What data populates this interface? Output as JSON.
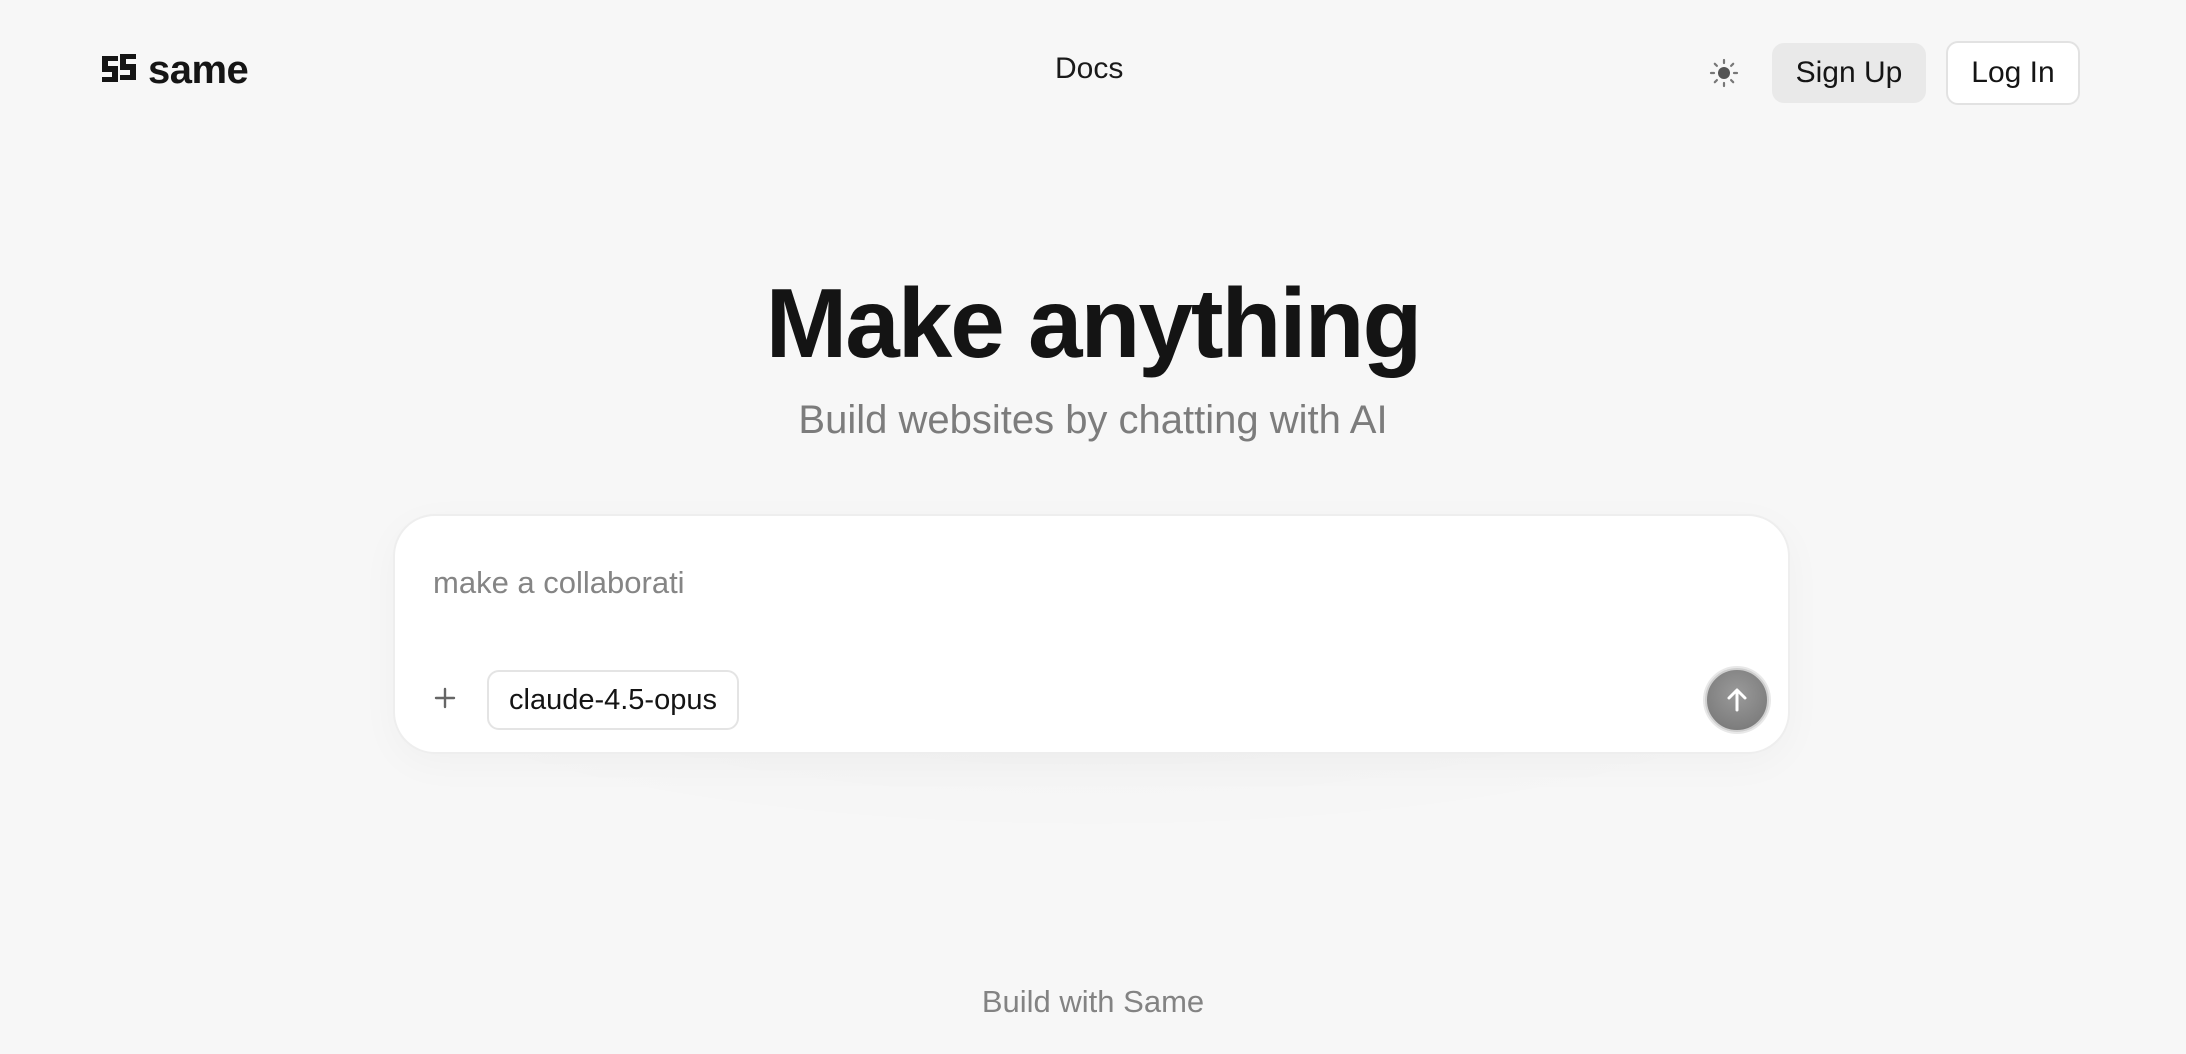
{
  "header": {
    "logo_text": "same",
    "logo_icon": "same-logo-icon",
    "nav_docs": "Docs",
    "theme_icon": "sun-icon",
    "signup_label": "Sign Up",
    "login_label": "Log In"
  },
  "hero": {
    "title": "Make anything",
    "subtitle": "Build websites by chatting with AI"
  },
  "prompt": {
    "input_value": "make a collaborati",
    "attach_icon": "plus-icon",
    "model_label": "claude-4.5-opus",
    "send_icon": "arrow-up-icon"
  },
  "footer": {
    "text": "Build with Same"
  },
  "colors": {
    "background": "#f7f7f7",
    "card": "#ffffff",
    "text_primary": "#141414",
    "text_muted": "#7c7c7c",
    "signup_bg": "#e9e9e9",
    "send_button": "#8a8a8a"
  }
}
